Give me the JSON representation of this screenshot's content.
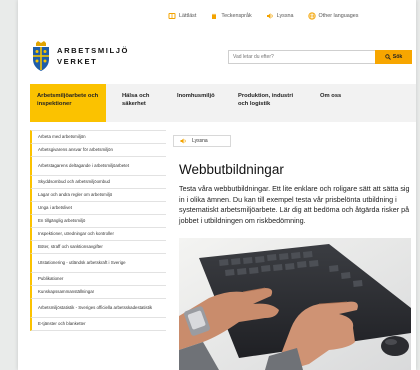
{
  "utility": {
    "items": [
      {
        "label": "Lättläst",
        "icon": "easy-read-icon"
      },
      {
        "label": "Teckenspråk",
        "icon": "sign-language-icon"
      },
      {
        "label": "Lyssna",
        "icon": "speaker-icon"
      },
      {
        "label": "Other languages",
        "icon": "globe-icon"
      }
    ]
  },
  "logo": {
    "line1": "ARBETSMILJÖ",
    "line2": "VERKET"
  },
  "search": {
    "placeholder": "Vad letar du efter?",
    "button_label": "Sök"
  },
  "nav": {
    "items": [
      {
        "label": "Arbetsmiljöarbete och inspektioner",
        "active": true
      },
      {
        "label": "Hälsa och säkerhet",
        "active": false
      },
      {
        "label": "Inomhusmiljö",
        "active": false
      },
      {
        "label": "Produktion, industri och logistik",
        "active": false
      },
      {
        "label": "Om oss",
        "active": false
      }
    ]
  },
  "sidebar": {
    "items": [
      {
        "label": "Arbeta med arbetsmiljön"
      },
      {
        "label": "Arbetsgivarens ansvar för arbetsmiljön"
      },
      {
        "label": "Arbetstagarens deltagande i arbetsmiljöarbetet"
      },
      {
        "label": "Skyddsombud och arbetsmiljöombud"
      },
      {
        "label": "Lagar och andra regler om arbetsmiljö"
      },
      {
        "label": "Unga i arbetslivet"
      },
      {
        "label": "En tillgänglig arbetsmiljö"
      },
      {
        "label": "Inspektioner, utredningar och kontroller"
      },
      {
        "label": "Böter, straff och sanktionsavgifter"
      },
      {
        "label": "Utstationering - utländsk arbetskraft i Sverige"
      },
      {
        "label": "Publikationer"
      },
      {
        "label": "Kunskapssammanställningar"
      },
      {
        "label": "Arbetsmiljöstatistik - Sveriges officiella arbetsskadestatistik"
      },
      {
        "label": "E-tjänster och blanketter"
      }
    ]
  },
  "content": {
    "listen_label": "Lyssna",
    "title": "Webbutbildningar",
    "lead": "Testa våra webbutbildningar. Ett lite enklare och roligare sätt att sätta sig in i olika ämnen. Du kan till exempel testa vår prisbelönta utbildning i systematiskt arbetsmiljöarbete. Lär dig att bedöma och åtgärda risker på jobbet i utbildningen om riskbedömning."
  },
  "colors": {
    "accent": "#fbc200",
    "button": "#f7a600",
    "icon": "#f3a300"
  }
}
